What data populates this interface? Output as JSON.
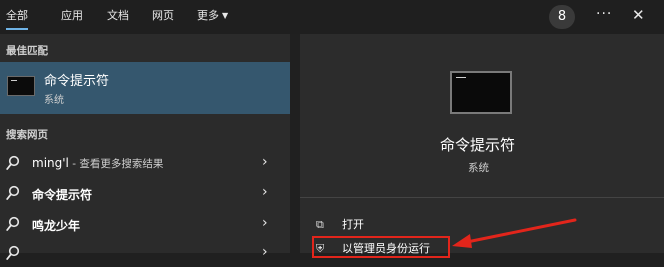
{
  "tabs": [
    {
      "label": "全部",
      "active": true
    },
    {
      "label": "应用",
      "active": false
    },
    {
      "label": "文档",
      "active": false
    },
    {
      "label": "网页",
      "active": false
    },
    {
      "label": "更多",
      "active": false
    }
  ],
  "header": {
    "badge": "8",
    "ellipsis": "···",
    "close": "✕"
  },
  "best_match": {
    "section": "最佳匹配",
    "title": "命令提示符",
    "subtitle": "系统"
  },
  "web": {
    "section": "搜索网页",
    "items": [
      {
        "label": "ming'l",
        "hint": " - 查看更多搜索结果"
      },
      {
        "label": "命令提示符",
        "hint": ""
      },
      {
        "label": "鸣龙少年",
        "hint": ""
      }
    ]
  },
  "preview": {
    "title": "命令提示符",
    "subtitle": "系统",
    "actions": [
      {
        "label": "打开",
        "icon": "open-icon"
      },
      {
        "label": "以管理员身份运行",
        "icon": "shield-icon"
      }
    ]
  },
  "colors": {
    "accent": "#6fb3e6",
    "selection": "#35576e",
    "highlight": "#e2251b"
  }
}
